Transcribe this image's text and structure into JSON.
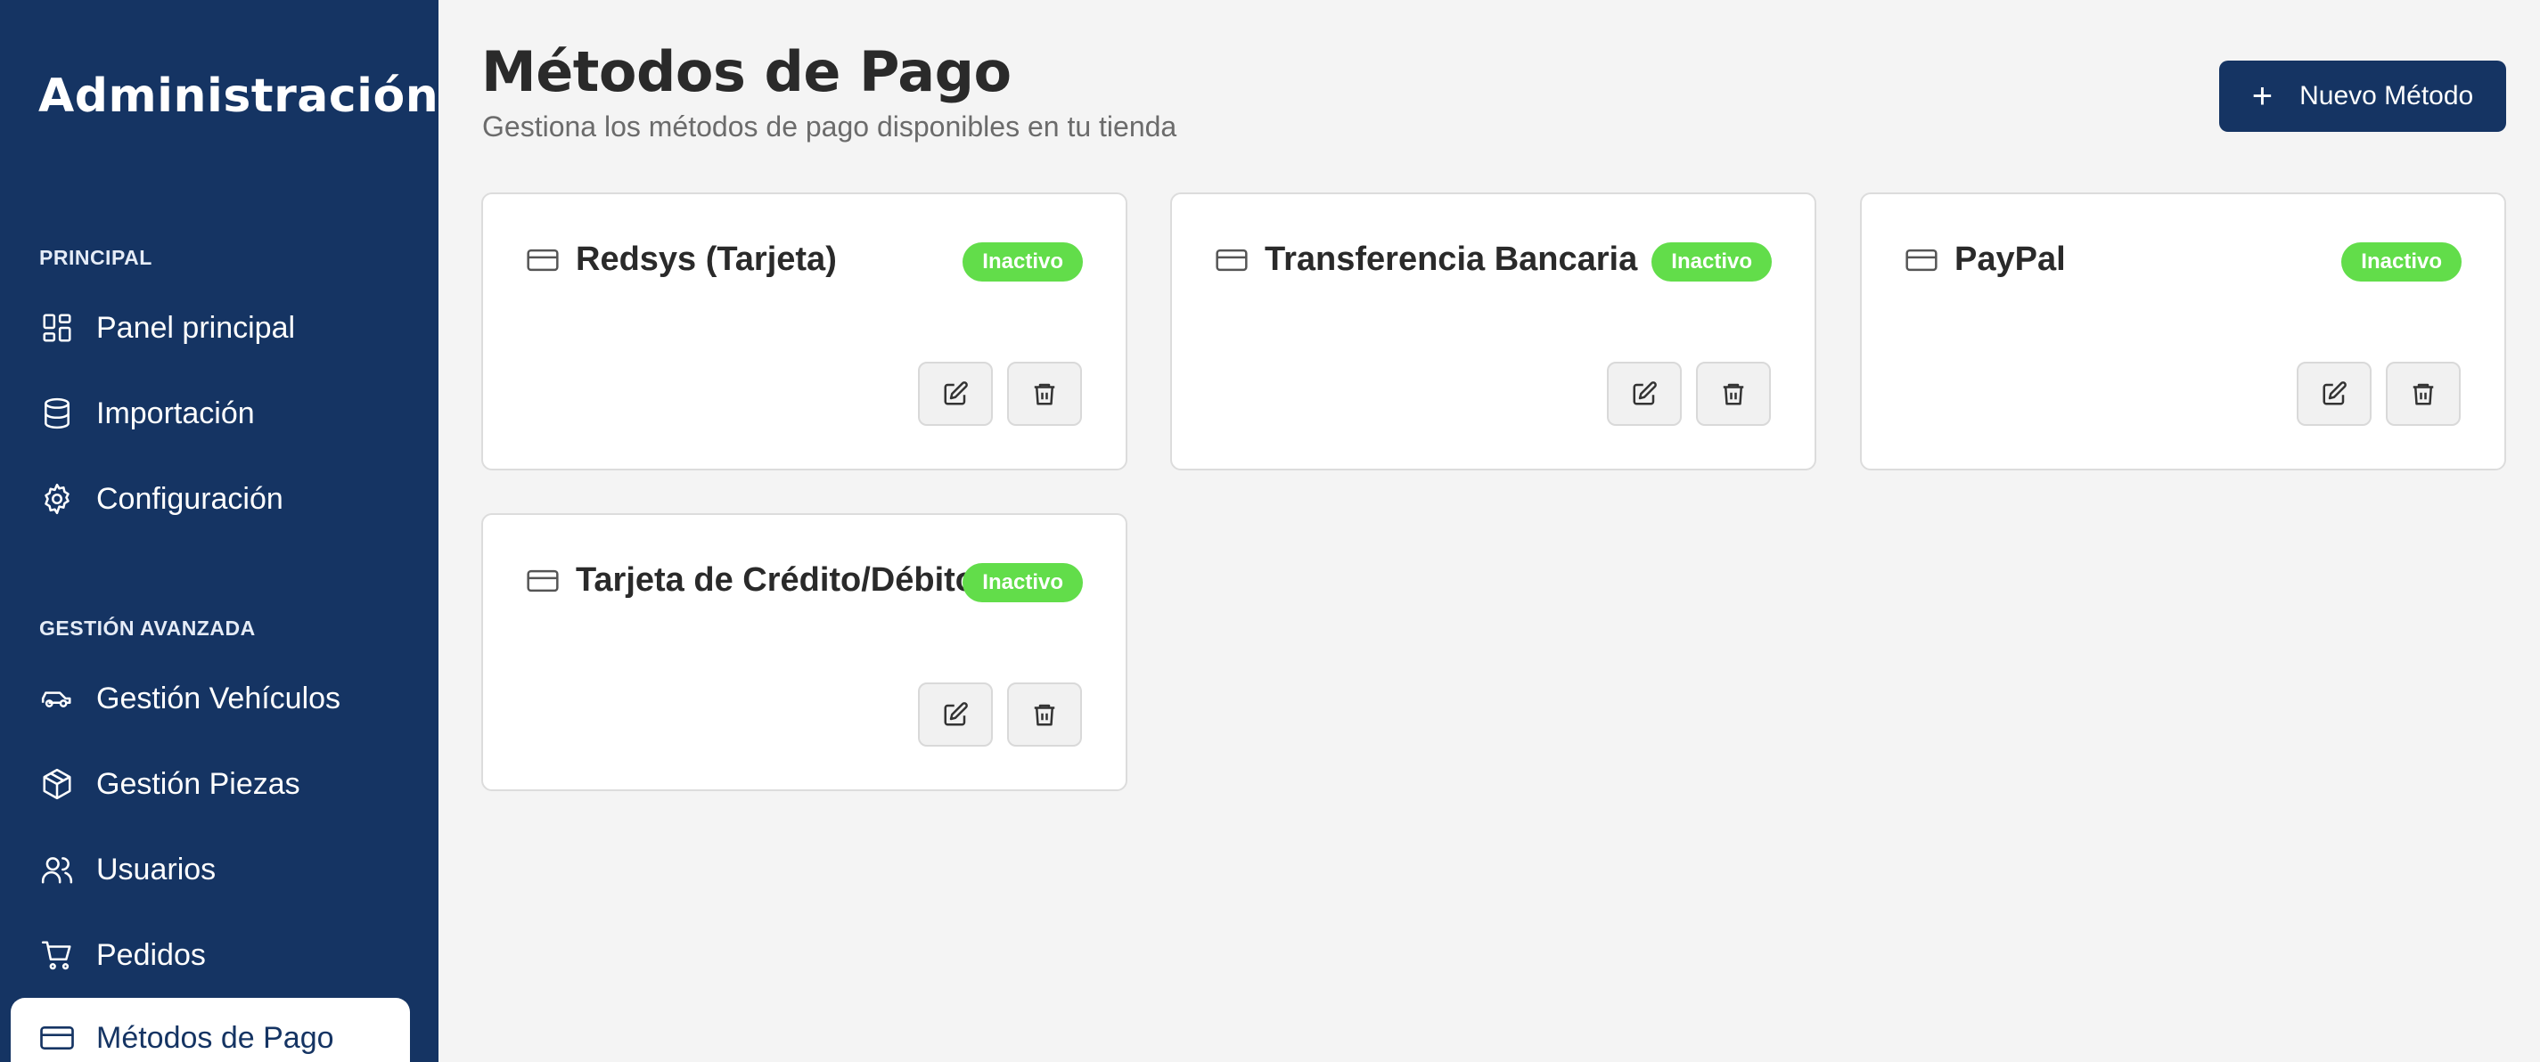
{
  "sidebar": {
    "brand": "Administración",
    "sections": [
      {
        "label": "PRINCIPAL"
      },
      {
        "label": "GESTIÓN AVANZADA"
      }
    ],
    "items": [
      {
        "label": "Panel principal",
        "icon": "dashboard-icon"
      },
      {
        "label": "Importación",
        "icon": "database-icon"
      },
      {
        "label": "Configuración",
        "icon": "gear-icon"
      },
      {
        "label": "Gestión Vehículos",
        "icon": "car-icon"
      },
      {
        "label": "Gestión Piezas",
        "icon": "box-icon"
      },
      {
        "label": "Usuarios",
        "icon": "users-icon"
      },
      {
        "label": "Pedidos",
        "icon": "cart-icon"
      },
      {
        "label": "Métodos de Pago",
        "icon": "credit-card-icon",
        "active": true
      }
    ]
  },
  "header": {
    "title": "Métodos de Pago",
    "subtitle": "Gestiona los métodos de pago disponibles en tu tienda",
    "new_button_label": "Nuevo Método"
  },
  "methods": [
    {
      "name": "Redsys (Tarjeta)",
      "status": "Inactivo"
    },
    {
      "name": "Transferencia Bancaria",
      "status": "Inactivo"
    },
    {
      "name": "PayPal",
      "status": "Inactivo"
    },
    {
      "name": "Tarjeta de Crédito/Débito",
      "status": "Inactivo"
    }
  ],
  "colors": {
    "sidebar_bg": "#153463",
    "accent": "#153463",
    "badge_inactive": "#62dd4a",
    "page_bg": "#f4f4f4"
  }
}
